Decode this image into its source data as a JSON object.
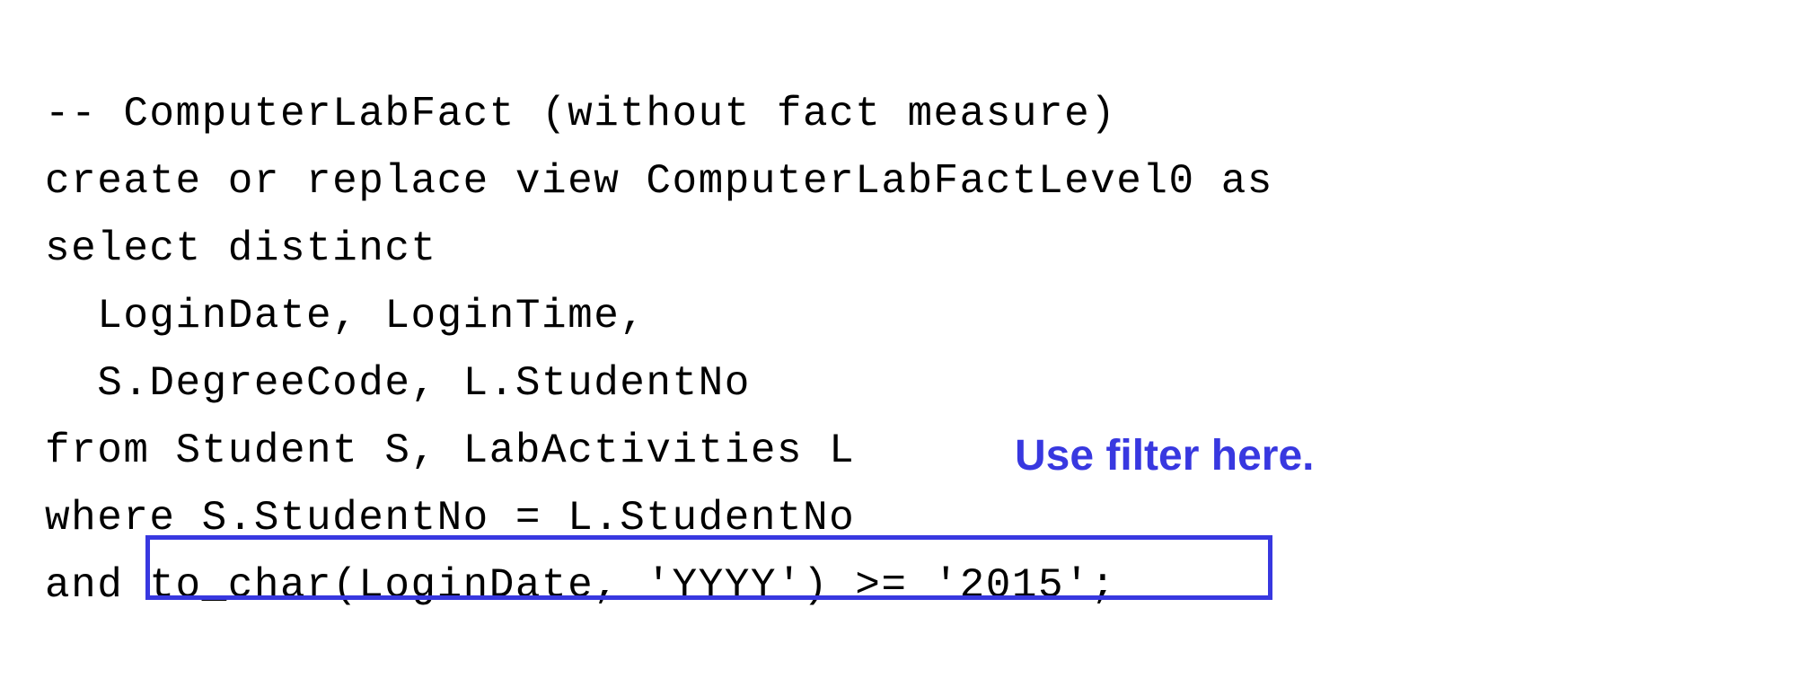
{
  "code": {
    "line1": "-- ComputerLabFact (without fact measure)",
    "line2": "create or replace view ComputerLabFactLevel0 as",
    "line3": "select distinct",
    "line4": "  LoginDate, LoginTime,",
    "line5": "  S.DegreeCode, L.StudentNo",
    "line6": "from Student S, LabActivities L",
    "line7": "where S.StudentNo = L.StudentNo",
    "line8": "and to_char(LoginDate, 'YYYY') >= '2015';"
  },
  "annotation": {
    "text": "Use filter here."
  }
}
